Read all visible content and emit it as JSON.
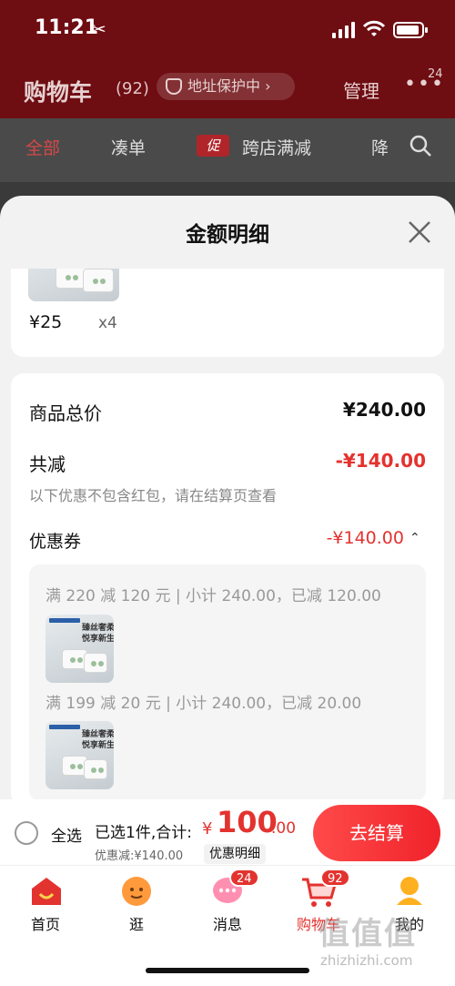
{
  "status_bar": {
    "time": "11:21",
    "scissor": "✂"
  },
  "header": {
    "title": "购物车",
    "count": "(92)",
    "address": "地址保护中 ›",
    "manage": "管理",
    "more": "•••",
    "more_badge": "24"
  },
  "tabs": {
    "all": "全部",
    "combine": "凑单",
    "promo_icon": "促",
    "cross_store": "跨店满减",
    "cut": "降"
  },
  "sheet": {
    "title": "金额明细",
    "item": {
      "price": "¥25",
      "qty": "x4"
    },
    "total_label": "商品总价",
    "total_value": "¥240.00",
    "reduce_label": "共减",
    "reduce_value": "-¥140.00",
    "note": "以下优惠不包含红包，请在结算页查看",
    "coupon_label": "优惠券",
    "coupon_value": "-¥140.00",
    "coupon_lines": [
      {
        "text": "满 220 减 120 元 | 小计 240.00，已减 120.00"
      },
      {
        "text": "满 199 减 20 元 | 小计 240.00，已减 20.00"
      }
    ],
    "product_slogan": "臻丝奢柔\n悦享新生"
  },
  "bottom_bar": {
    "select_all": "全选",
    "selected": "已选1件,合计:",
    "yen": "¥",
    "amount_int": "100",
    "amount_dec": ".00",
    "discount": "优惠减:¥140.00",
    "detail": "优惠明细",
    "checkout": "去结算"
  },
  "tabbar": {
    "items": [
      {
        "label": "首页"
      },
      {
        "label": "逛"
      },
      {
        "label": "消息",
        "badge": "24"
      },
      {
        "label": "购物车",
        "badge": "92"
      },
      {
        "label": "我的"
      }
    ]
  },
  "watermark": {
    "main": "值值值",
    "url": "zhizhizhi.com"
  },
  "colors": {
    "brand_red": "#e3332f",
    "header_bg": "#6e0d12"
  }
}
